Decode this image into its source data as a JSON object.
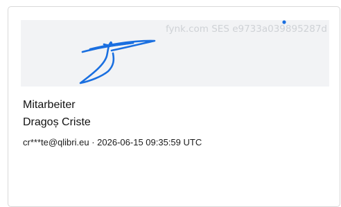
{
  "signature": {
    "meta_text": "fynk.com SES e9733a039895287d",
    "ink_color": "#1a6fe0",
    "background_color": "#f2f3f5"
  },
  "signer": {
    "role": "Mitarbeiter",
    "name": "Dragoș Criste",
    "email": "cr***te@qlibri.eu",
    "separator": "·",
    "timestamp": "2026-06-15 09:35:59 UTC"
  }
}
